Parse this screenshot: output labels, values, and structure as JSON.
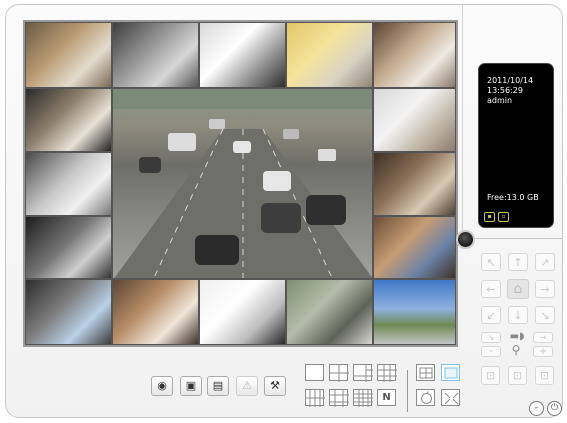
{
  "status": {
    "date": "2011/10/14",
    "time": "13:56:29",
    "user": "admin",
    "free_space": "Free:13.0 GB"
  },
  "icons": {
    "status_left": "disk-icon",
    "status_right": "network-icon",
    "power_left": "minimize-icon",
    "power_right": "power-icon"
  },
  "ptz": {
    "zoom_minus": "-",
    "zoom_plus": "+"
  },
  "layout_buttons": {
    "n_label": "N"
  },
  "colors": {
    "accent": "#7fc3e6",
    "panel_bg": "#000000",
    "status_icon": "#c9c55a"
  }
}
